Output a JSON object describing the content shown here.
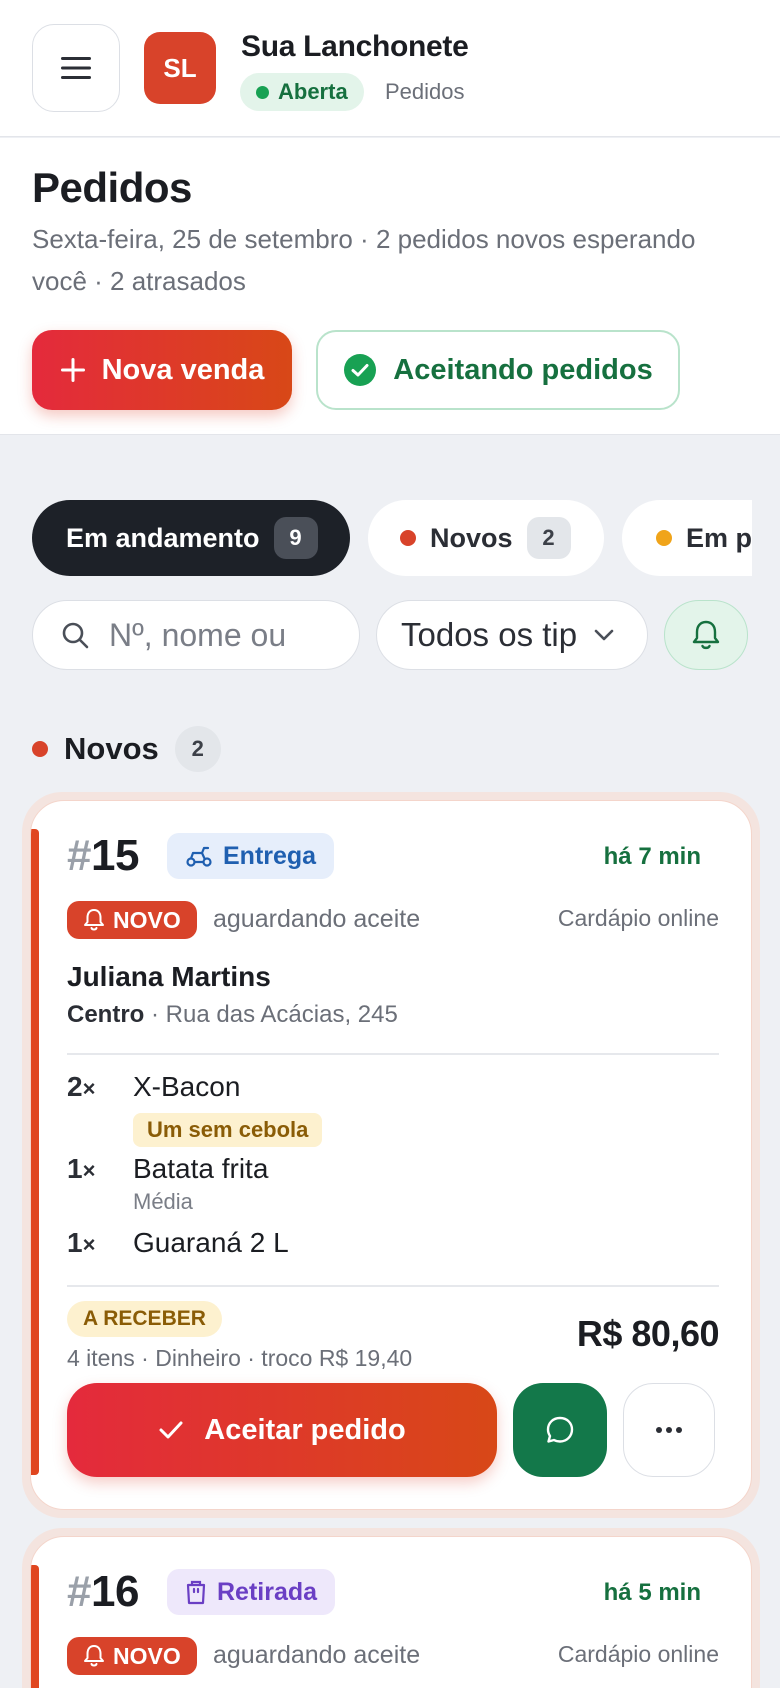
{
  "header": {
    "avatar_initials": "SL",
    "store_name": "Sua Lanchonete",
    "status": "Aberta",
    "section": "Pedidos"
  },
  "page": {
    "title": "Pedidos",
    "subtitle": "Sexta-feira, 25 de setembro · 2 pedidos novos esperando você · 2 atrasados",
    "new_sale_label": "Nova venda",
    "accepting_label": "Aceitando pedidos"
  },
  "tabs": [
    {
      "label": "Em andamento",
      "count": "9"
    },
    {
      "label": "Novos",
      "count": "2"
    },
    {
      "label": "Em pr"
    }
  ],
  "filters": {
    "search_placeholder": "Nº, nome ou",
    "type_value": "Todos os tip"
  },
  "section": {
    "title": "Novos",
    "count": "2"
  },
  "orders": [
    {
      "hash": "#",
      "number": "15",
      "type": "Entrega",
      "time": "há 7 min",
      "badge": "NOVO",
      "status": "aguardando aceite",
      "origin": "Cardápio online",
      "customer": "Juliana Martins",
      "neighborhood": "Centro",
      "address": " · Rua das Acácias, 245",
      "items": [
        {
          "qty": "2",
          "mult": "×",
          "name": "X-Bacon",
          "note": "Um sem cebola"
        },
        {
          "qty": "1",
          "mult": "×",
          "name": "Batata frita",
          "variant": "Média"
        },
        {
          "qty": "1",
          "mult": "×",
          "name": "Guaraná 2 L"
        }
      ],
      "payment_badge": "A RECEBER",
      "payment_meta": "4 itens · Dinheiro · troco R$ 19,40",
      "total": "R$ 80,60",
      "accept_label": "Aceitar pedido"
    },
    {
      "hash": "#",
      "number": "16",
      "type": "Retirada",
      "time": "há 5 min",
      "badge": "NOVO",
      "status": "aguardando aceite",
      "origin": "Cardápio online"
    }
  ],
  "colors": {
    "accent": "#d8432a",
    "accent_gradient_start": "#e42a3c",
    "success": "#16703f",
    "dark": "#1d2128",
    "delivery_chip": "#1f5fb0",
    "pickup_chip": "#6a3fc4",
    "warning_dot": "#f0a41a"
  }
}
